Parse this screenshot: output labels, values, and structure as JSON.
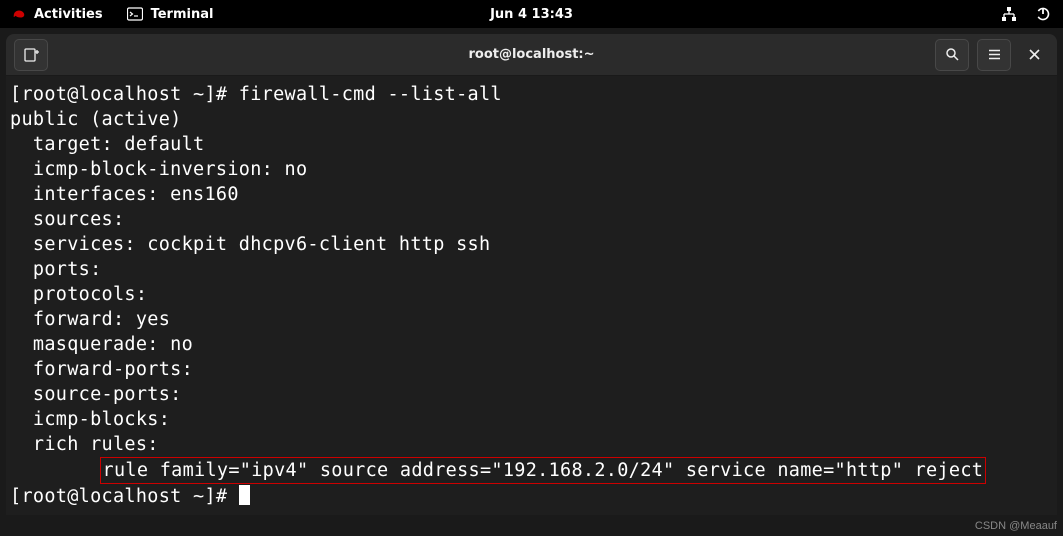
{
  "topbar": {
    "activities": "Activities",
    "terminal": "Terminal",
    "datetime": "Jun 4  13:43"
  },
  "window": {
    "title": "root@localhost:~"
  },
  "terminal": {
    "line1": "[root@localhost ~]# firewall-cmd --list-all",
    "line2": "public (active)",
    "line3": "  target: default",
    "line4": "  icmp-block-inversion: no",
    "line5": "  interfaces: ens160",
    "line6": "  sources: ",
    "line7": "  services: cockpit dhcpv6-client http ssh",
    "line8": "  ports: ",
    "line9": "  protocols: ",
    "line10": "  forward: yes",
    "line11": "  masquerade: no",
    "line12": "  forward-ports: ",
    "line13": "  source-ports: ",
    "line14": "  icmp-blocks: ",
    "line15": "  rich rules: ",
    "richrule_indent": "        ",
    "richrule": "rule family=\"ipv4\" source address=\"192.168.2.0/24\" service name=\"http\" reject",
    "prompt2": "[root@localhost ~]# "
  },
  "watermark": "CSDN @Meaauf"
}
